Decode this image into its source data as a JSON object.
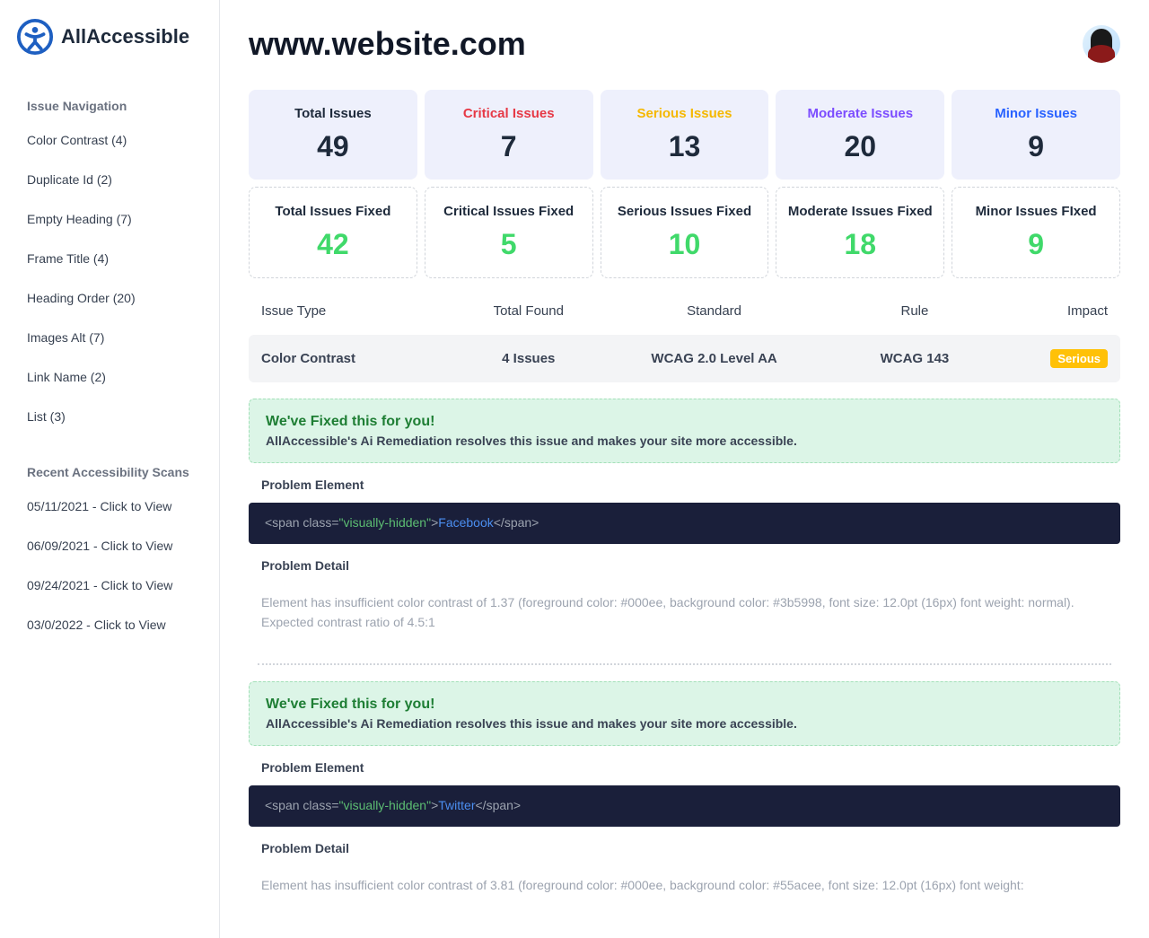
{
  "brand": "AllAccessible",
  "page_title": "www.website.com",
  "sidebar": {
    "nav_heading": "Issue Navigation",
    "items": [
      "Color Contrast (4)",
      "Duplicate Id (2)",
      "Empty Heading (7)",
      "Frame Title (4)",
      "Heading Order (20)",
      "Images Alt (7)",
      "Link Name (2)",
      "List (3)"
    ],
    "scans_heading": "Recent Accessibility Scans",
    "scans": [
      "05/11/2021 - Click to View",
      "06/09/2021 - Click to View",
      "09/24/2021 - Click to View",
      "03/0/2022 - Click to View"
    ]
  },
  "stats_found": [
    {
      "label": "Total Issues",
      "value": "49",
      "cls": "lbl-total"
    },
    {
      "label": "Critical Issues",
      "value": "7",
      "cls": "lbl-critical"
    },
    {
      "label": "Serious Issues",
      "value": "13",
      "cls": "lbl-serious"
    },
    {
      "label": "Moderate Issues",
      "value": "20",
      "cls": "lbl-moderate"
    },
    {
      "label": "Minor Issues",
      "value": "9",
      "cls": "lbl-minor"
    }
  ],
  "stats_fixed": [
    {
      "label": "Total Issues Fixed",
      "value": "42"
    },
    {
      "label": "Critical Issues Fixed",
      "value": "5"
    },
    {
      "label": "Serious Issues Fixed",
      "value": "10"
    },
    {
      "label": "Moderate Issues Fixed",
      "value": "18"
    },
    {
      "label": "Minor Issues FIxed",
      "value": "9"
    }
  ],
  "table": {
    "headers": [
      "Issue Type",
      "Total Found",
      "Standard",
      "Rule",
      "Impact"
    ],
    "row": {
      "type": "Color Contrast",
      "found": "4 Issues",
      "standard": "WCAG 2.0 Level AA",
      "rule": "WCAG 143",
      "impact": "Serious"
    }
  },
  "banner": {
    "title": "We've Fixed this for you!",
    "desc": "AllAccessible's Ai Remediation resolves this issue and makes your site more accessible."
  },
  "labels": {
    "problem_element": "Problem Element",
    "problem_detail": "Problem Detail"
  },
  "issues": [
    {
      "code": {
        "cls": "visually-hidden",
        "text": "Facebook"
      },
      "detail": "Element has insufficient color contrast of 1.37 (foreground color: #000ee, background color: #3b5998, font size: 12.0pt (16px) font weight: normal). Expected contrast ratio of 4.5:1"
    },
    {
      "code": {
        "cls": "visually-hidden",
        "text": "Twitter"
      },
      "detail": "Element has insufficient color contrast of 3.81 (foreground color: #000ee, background color: #55acee, font size: 12.0pt (16px) font weight:"
    }
  ]
}
